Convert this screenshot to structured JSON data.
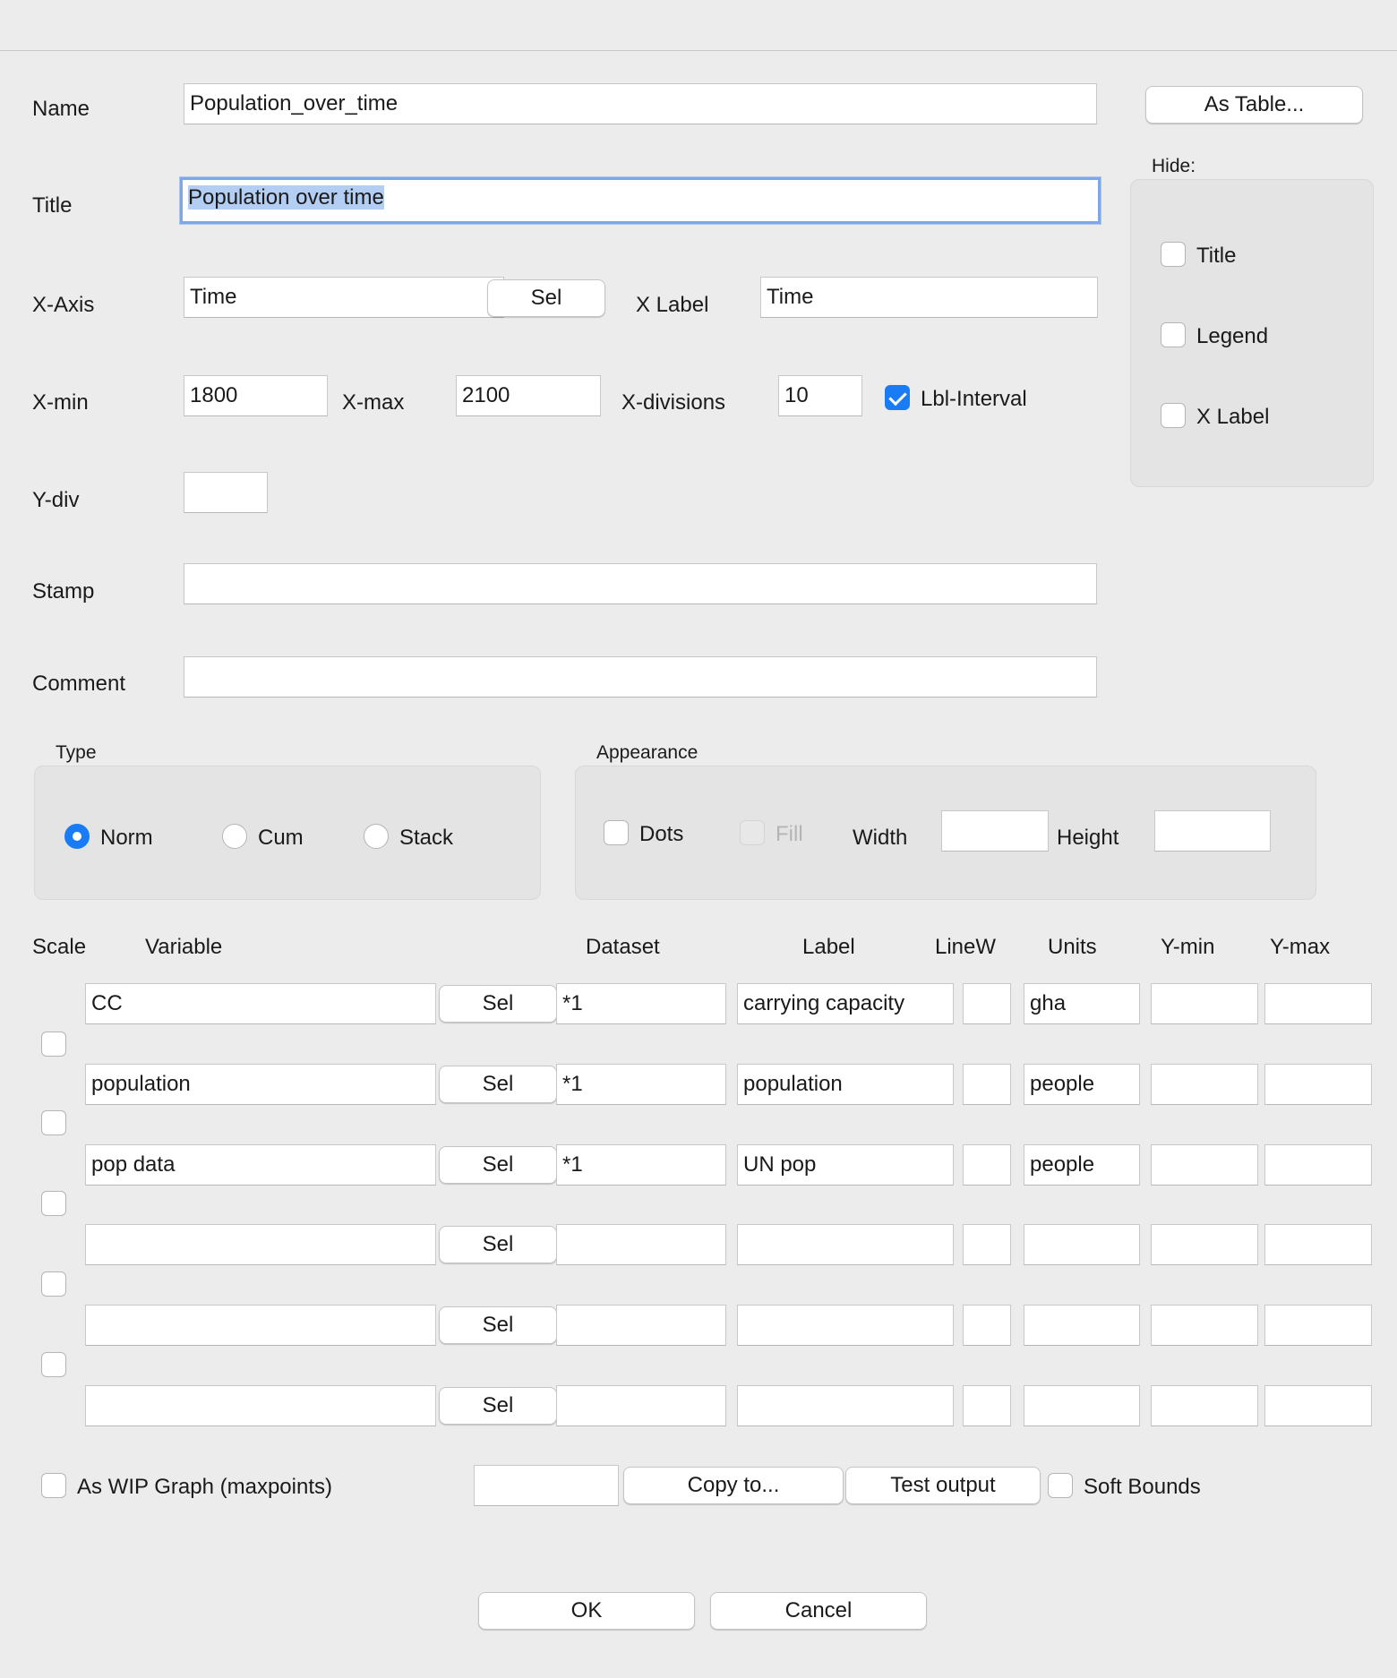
{
  "form": {
    "name_label": "Name",
    "name_value": "Population_over_time",
    "as_table_button": "As Table...",
    "title_label": "Title",
    "title_value": "Population over time",
    "xaxis_label": "X-Axis",
    "xaxis_value": "Time",
    "sel_label": "Sel",
    "xlabel_label": "X Label",
    "xlabel_value": "Time",
    "xmin_label": "X-min",
    "xmin_value": "1800",
    "xmax_label": "X-max",
    "xmax_value": "2100",
    "xdiv_label": "X-divisions",
    "xdiv_value": "10",
    "lbl_interval_label": "Lbl-Interval",
    "lbl_interval_checked": true,
    "ydiv_label": "Y-div",
    "ydiv_value": "",
    "stamp_label": "Stamp",
    "stamp_value": "",
    "comment_label": "Comment",
    "comment_value": ""
  },
  "hide": {
    "heading": "Hide:",
    "title": "Title",
    "legend": "Legend",
    "xlabel": "X Label"
  },
  "type_group": {
    "heading": "Type",
    "options": [
      "Norm",
      "Cum",
      "Stack"
    ],
    "selected": "Norm"
  },
  "appearance": {
    "heading": "Appearance",
    "dots": "Dots",
    "fill": "Fill",
    "width_label": "Width",
    "width_value": "",
    "height_label": "Height",
    "height_value": ""
  },
  "table": {
    "headers": {
      "scale": "Scale",
      "variable": "Variable",
      "dataset": "Dataset",
      "label": "Label",
      "linew": "LineW",
      "units": "Units",
      "ymin": "Y-min",
      "ymax": "Y-max"
    },
    "rows": [
      {
        "variable": "CC",
        "dataset": "*1",
        "label": "carrying capacity",
        "linew": "",
        "units": "gha",
        "ymin": "",
        "ymax": ""
      },
      {
        "variable": "population",
        "dataset": "*1",
        "label": "population",
        "linew": "",
        "units": "people",
        "ymin": "",
        "ymax": ""
      },
      {
        "variable": "pop data",
        "dataset": "*1",
        "label": "UN pop",
        "linew": "",
        "units": "people",
        "ymin": "",
        "ymax": ""
      },
      {
        "variable": "",
        "dataset": "",
        "label": "",
        "linew": "",
        "units": "",
        "ymin": "",
        "ymax": ""
      },
      {
        "variable": "",
        "dataset": "",
        "label": "",
        "linew": "",
        "units": "",
        "ymin": "",
        "ymax": ""
      },
      {
        "variable": "",
        "dataset": "",
        "label": "",
        "linew": "",
        "units": "",
        "ymin": "",
        "ymax": ""
      }
    ]
  },
  "bottom": {
    "wip_label": "As WIP Graph (maxpoints)",
    "wip_value": "",
    "copy_to": "Copy to...",
    "test_output": "Test output",
    "soft_bounds": "Soft Bounds",
    "ok": "OK",
    "cancel": "Cancel"
  }
}
